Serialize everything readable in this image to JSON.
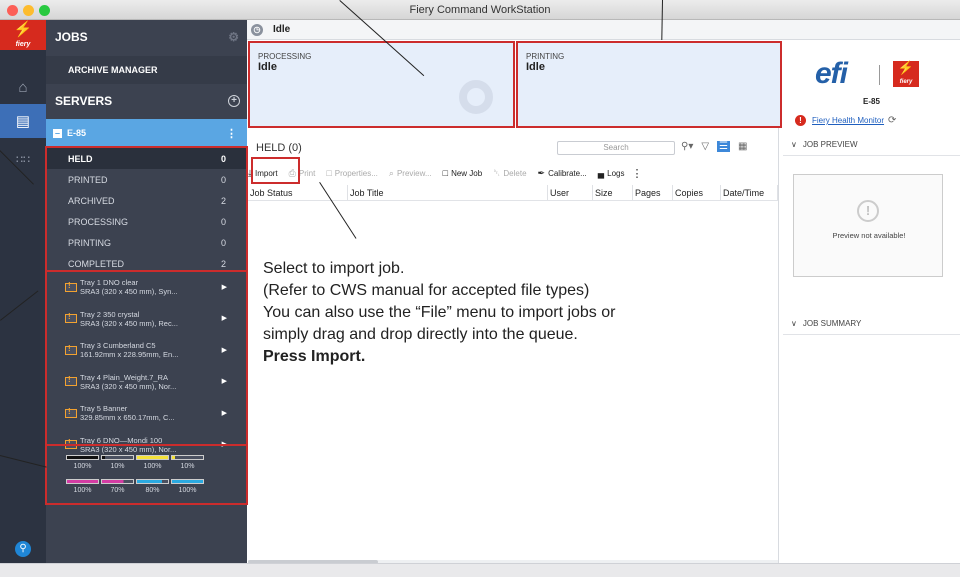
{
  "window": {
    "title": "Fiery Command WorkStation"
  },
  "colors": {
    "accent": "#5aa6e3",
    "callout": "#cc2c2c",
    "panel": "#3c4250"
  },
  "rail": {
    "logo_symbol": "⚡",
    "logo_word": "fiery",
    "icons": [
      "home-icon",
      "server-list-icon",
      "apps-grid-icon",
      "search-icon"
    ]
  },
  "jobs_panel": {
    "jobs_header": "JOBS",
    "archive_manager": "ARCHIVE MANAGER",
    "servers_header": "SERVERS",
    "server_name": "E-85",
    "queues": [
      {
        "label": "HELD",
        "count": "0"
      },
      {
        "label": "PRINTED",
        "count": "0"
      },
      {
        "label": "ARCHIVED",
        "count": "2"
      },
      {
        "label": "PROCESSING",
        "count": "0"
      },
      {
        "label": "PRINTING",
        "count": "0"
      },
      {
        "label": "COMPLETED",
        "count": "2"
      }
    ],
    "trays": [
      {
        "line1": "Tray 1 DNO clear",
        "line2": "SRA3 (320 x 450 mm), Syn..."
      },
      {
        "line1": "Tray 2 350 crystal",
        "line2": "SRA3 (320 x 450 mm), Rec..."
      },
      {
        "line1": "Tray 3 Cumberland C5",
        "line2": "161.92mm x 228.95mm, En..."
      },
      {
        "line1": "Tray 4 Plain_Weight.7_RA",
        "line2": "SRA3 (320 x 450 mm), Nor..."
      },
      {
        "line1": "Tray 5 Banner",
        "line2": "329.85mm x 650.17mm, C..."
      },
      {
        "line1": "Tray 6 DNO—Mondi 100",
        "line2": "SRA3 (320 x 450 mm), Nor..."
      }
    ],
    "toner_row1": [
      {
        "label": "100%",
        "color": "#111111",
        "level": 1.0
      },
      {
        "label": "10%",
        "color": "#111111",
        "level": 0.1
      },
      {
        "label": "100%",
        "color": "#f4e23a",
        "level": 1.0
      },
      {
        "label": "10%",
        "color": "#f4e23a",
        "level": 0.1
      }
    ],
    "toner_row2": [
      {
        "label": "100%",
        "color": "#d43ca4",
        "level": 1.0
      },
      {
        "label": "70%",
        "color": "#d43ca4",
        "level": 0.7
      },
      {
        "label": "80%",
        "color": "#2aa9e0",
        "level": 0.8
      },
      {
        "label": "100%",
        "color": "#2aa9e0",
        "level": 1.0
      }
    ]
  },
  "status": {
    "state": "Idle",
    "processing_caption": "PROCESSING",
    "processing_value": "Idle",
    "printing_caption": "PRINTING",
    "printing_value": "Idle"
  },
  "info": {
    "brand": "efi",
    "fiery_word": "fiery",
    "model": "E-85",
    "health_link": "Fiery Health Monitor"
  },
  "held": {
    "title": "HELD (0)",
    "search_placeholder": "Search",
    "toolbar": [
      {
        "label": "Import",
        "icon": "⤓",
        "enabled": true,
        "name": "import-button"
      },
      {
        "label": "Print",
        "icon": "⎙",
        "enabled": false,
        "name": "print-button"
      },
      {
        "label": "Properties...",
        "icon": "□",
        "enabled": false,
        "name": "properties-button"
      },
      {
        "label": "Preview...",
        "icon": "⌕",
        "enabled": false,
        "name": "preview-button"
      },
      {
        "label": "New Job",
        "icon": "□",
        "enabled": true,
        "name": "new-job-button"
      },
      {
        "label": "Delete",
        "icon": "␡",
        "enabled": false,
        "name": "delete-button"
      },
      {
        "label": "Calibrate...",
        "icon": "✒",
        "enabled": true,
        "name": "calibrate-button"
      },
      {
        "label": "Logs",
        "icon": "▄",
        "enabled": true,
        "name": "logs-button"
      }
    ],
    "columns": [
      "Job Status",
      "Job Title",
      "User",
      "Size",
      "Pages",
      "Copies",
      "Date/Time"
    ]
  },
  "right_panel": {
    "job_preview": "JOB PREVIEW",
    "preview_empty": "Preview not available!",
    "job_summary": "JOB SUMMARY"
  },
  "annotation": {
    "line1": "Select to import job.",
    "line2": "(Refer to CWS manual for accepted file types)",
    "line3": "You can also use the “File” menu to import jobs or",
    "line4": "simply drag and drop directly into the queue.",
    "emphasis": "Press Import."
  }
}
